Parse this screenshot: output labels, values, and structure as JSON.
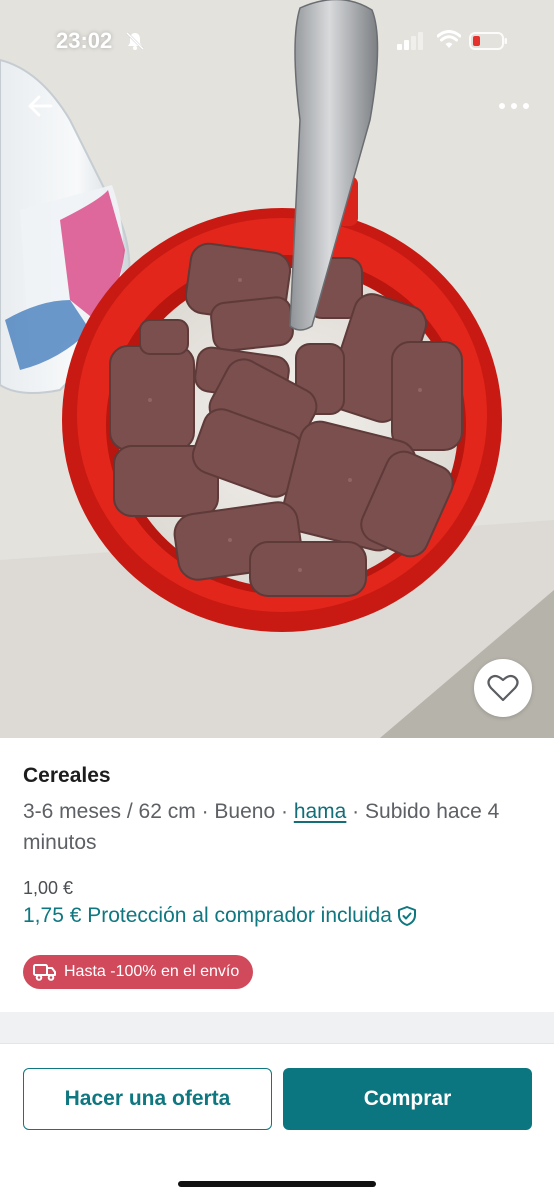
{
  "status_bar": {
    "time": "23:02",
    "icons": [
      "bell-slash-icon",
      "cellular-signal-icon",
      "wifi-icon",
      "battery-low-icon"
    ],
    "battery_color": "#e5322d"
  },
  "nav": {
    "back_icon": "arrow-left-icon",
    "more_icon": "more-dots-icon",
    "favorite_icon": "heart-outline-icon"
  },
  "listing": {
    "title": "Cereales",
    "size": "3-6 meses / 62 cm",
    "separator": " · ",
    "condition": "Bueno",
    "brand": "hama",
    "uploaded": "Subido hace 4 minutos",
    "price": "1,00 €",
    "total_price_text": "1,75 € Protección al comprador incluida",
    "protection_icon": "shield-check-icon",
    "shipping_badge": "Hasta -100% en el envío",
    "shipping_icon": "truck-icon"
  },
  "actions": {
    "offer_label": "Hacer una oferta",
    "buy_label": "Comprar"
  },
  "colors": {
    "accent": "#0c7680",
    "badge": "#d04a5c",
    "text_secondary": "#5d6064"
  }
}
